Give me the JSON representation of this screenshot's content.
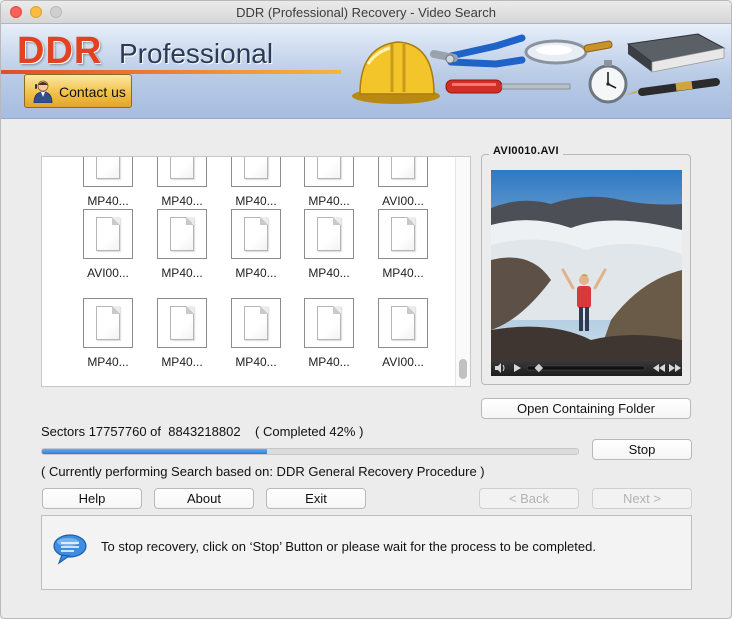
{
  "window": {
    "title": "DDR (Professional) Recovery - Video Search"
  },
  "banner": {
    "logo_brand": "DDR",
    "logo_product": "Professional",
    "contact_label": "Contact us"
  },
  "files": {
    "rows": [
      [
        "MP40...",
        "MP40...",
        "MP40...",
        "MP40...",
        "AVI00..."
      ],
      [
        "AVI00...",
        "MP40...",
        "MP40...",
        "MP40...",
        "MP40..."
      ],
      [
        "MP40...",
        "MP40...",
        "MP40...",
        "MP40...",
        "AVI00..."
      ]
    ]
  },
  "preview": {
    "title": "AVI0010.AVI",
    "open_folder_label": "Open Containing Folder",
    "playback_position": 0.1
  },
  "progress": {
    "sectors_label": "Sectors",
    "sectors_done": "17757760",
    "of_label": "of",
    "sectors_total": "8843218802",
    "completed_text": "( Completed 42% )",
    "percent": 42,
    "stop_label": "Stop"
  },
  "status": {
    "text": "( Currently performing Search based on: DDR General Recovery Procedure )"
  },
  "buttons": {
    "help": "Help",
    "about": "About",
    "exit": "Exit",
    "back": "< Back",
    "next": "Next >"
  },
  "message": {
    "text": "To stop recovery, click on ‘Stop’ Button or please wait for the process to be completed."
  },
  "colors": {
    "accent": "#2c7de0",
    "logo_red": "#e2421f",
    "contact_gold": "#f1c24b"
  }
}
